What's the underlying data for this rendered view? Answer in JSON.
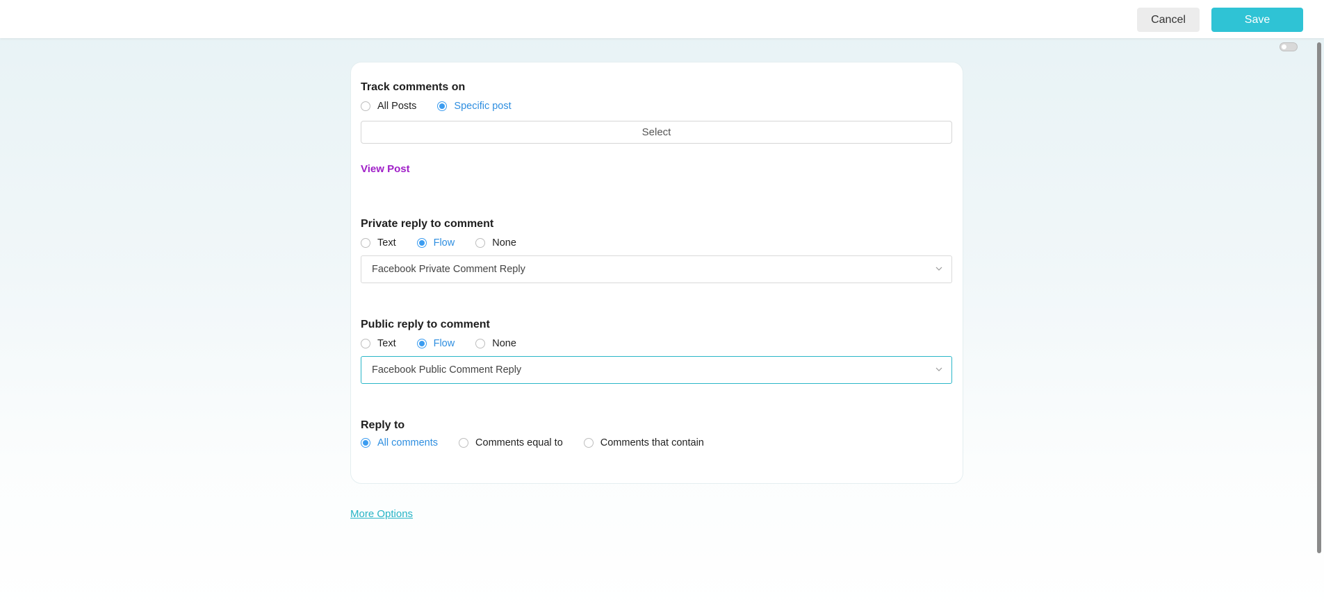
{
  "header": {
    "cancel_label": "Cancel",
    "save_label": "Save"
  },
  "track": {
    "title": "Track comments on",
    "options": [
      "All Posts",
      "Specific post"
    ],
    "selected": "Specific post",
    "select_label": "Select",
    "view_post_label": "View Post"
  },
  "private_reply": {
    "title": "Private reply to comment",
    "options": [
      "Text",
      "Flow",
      "None"
    ],
    "selected": "Flow",
    "dropdown_value": "Facebook Private Comment Reply"
  },
  "public_reply": {
    "title": "Public reply to comment",
    "options": [
      "Text",
      "Flow",
      "None"
    ],
    "selected": "Flow",
    "dropdown_value": "Facebook Public Comment Reply"
  },
  "reply_to": {
    "title": "Reply to",
    "options": [
      "All comments",
      "Comments equal to",
      "Comments that contain"
    ],
    "selected": "All comments"
  },
  "more_options_label": "More Options",
  "colors": {
    "accent": "#2fc3d5",
    "radio_selected": "#3b9cf0",
    "view_post": "#a020c8"
  }
}
